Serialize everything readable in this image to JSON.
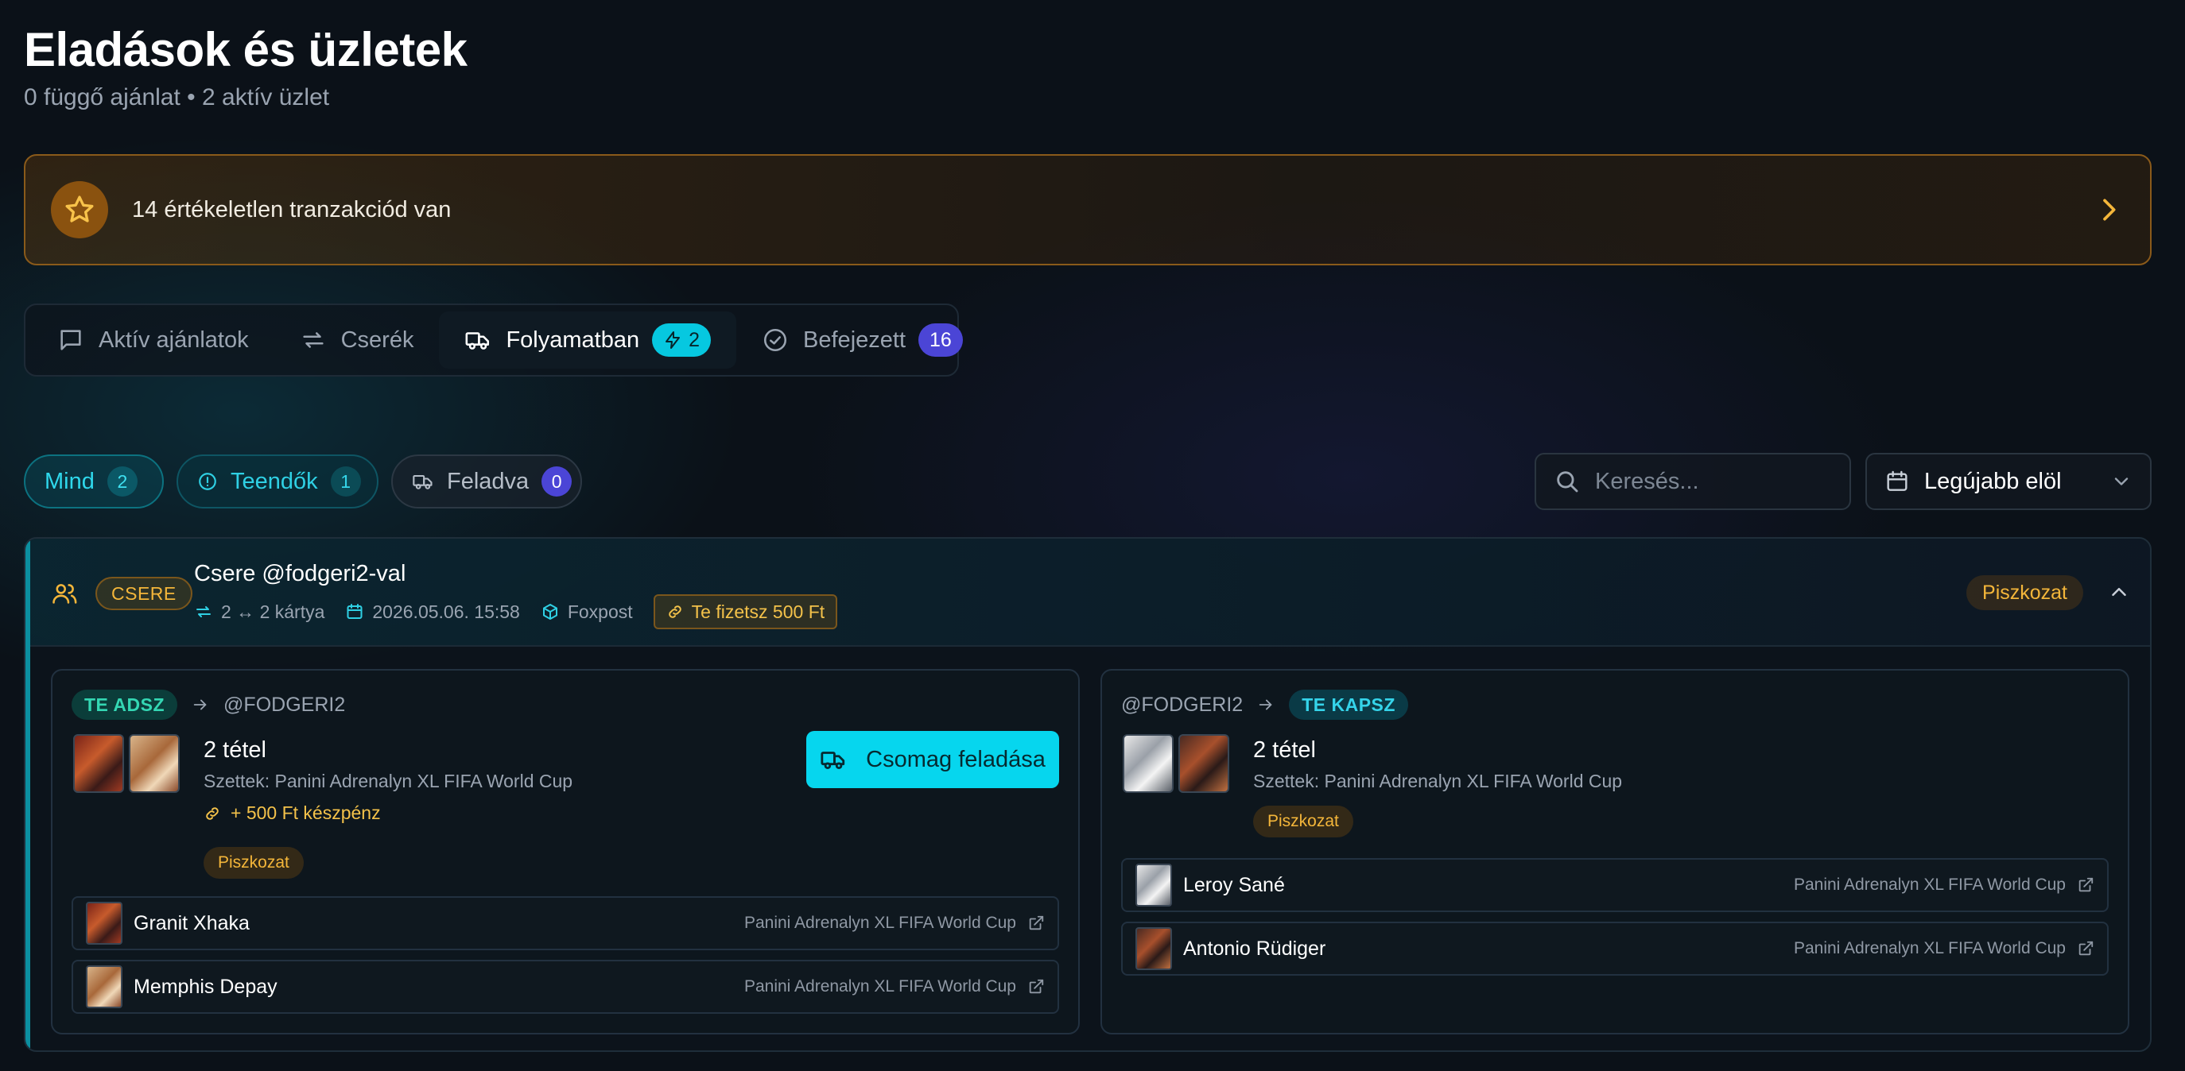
{
  "header": {
    "title": "Eladások és üzletek",
    "subtitle": "0 függő ajánlat • 2 aktív üzlet"
  },
  "banner": {
    "text": "14 értékeletlen tranzakciód van",
    "accent": "#f4b63a"
  },
  "tabs": [
    {
      "label": "Aktív ajánlatok",
      "icon": "message-square-icon",
      "active": false
    },
    {
      "label": "Cserék",
      "icon": "swap-icon",
      "active": false
    },
    {
      "label": "Folyamatban",
      "icon": "truck-icon",
      "active": true,
      "badge": "2",
      "badge_icon": "bolt-icon"
    },
    {
      "label": "Befejezett",
      "icon": "check-circle-icon",
      "active": false,
      "badge": "16"
    }
  ],
  "filters": [
    {
      "label": "Mind",
      "count": "2",
      "active": true
    },
    {
      "label": "Teendők",
      "count": "1",
      "icon": "alert-circle-icon"
    },
    {
      "label": "Feladva",
      "count": "0",
      "icon": "truck-icon"
    }
  ],
  "search": {
    "placeholder": "Keresés...",
    "value": ""
  },
  "sort": {
    "selected": "Legújabb elöl"
  },
  "deal": {
    "type_badge": "CSERE",
    "title": "Csere @fodgeri2-val",
    "meta": {
      "cards": "2 ↔ 2 kártya",
      "date": "2026.05.06. 15:58",
      "shipping": "Foxpost",
      "payment": "Te fizetsz 500 Ft"
    },
    "status": "Piszkozat",
    "left": {
      "role": "TE ADSZ",
      "counterparty": "@FODGERI2",
      "summary_title": "2 tétel",
      "sets": "Szettek: Panini Adrenalyn XL FIFA World Cup",
      "cash": "+ 500 Ft készpénz",
      "status": "Piszkozat",
      "action": "Csomag feladása",
      "cards": [
        {
          "name": "Granit Xhaka",
          "set": "Panini Adrenalyn XL FIFA World Cup"
        },
        {
          "name": "Memphis Depay",
          "set": "Panini Adrenalyn XL FIFA World Cup"
        }
      ]
    },
    "right": {
      "counterparty": "@FODGERI2",
      "role": "TE KAPSZ",
      "summary_title": "2 tétel",
      "sets": "Szettek: Panini Adrenalyn XL FIFA World Cup",
      "status": "Piszkozat",
      "cards": [
        {
          "name": "Leroy Sané",
          "set": "Panini Adrenalyn XL FIFA World Cup"
        },
        {
          "name": "Antonio Rüdiger",
          "set": "Panini Adrenalyn XL FIFA World Cup"
        }
      ]
    }
  },
  "colors": {
    "accent_cyan": "#06d6ee",
    "accent_amber": "#f4b63a",
    "accent_indigo": "#4b45d6",
    "background": "#0b1118"
  }
}
